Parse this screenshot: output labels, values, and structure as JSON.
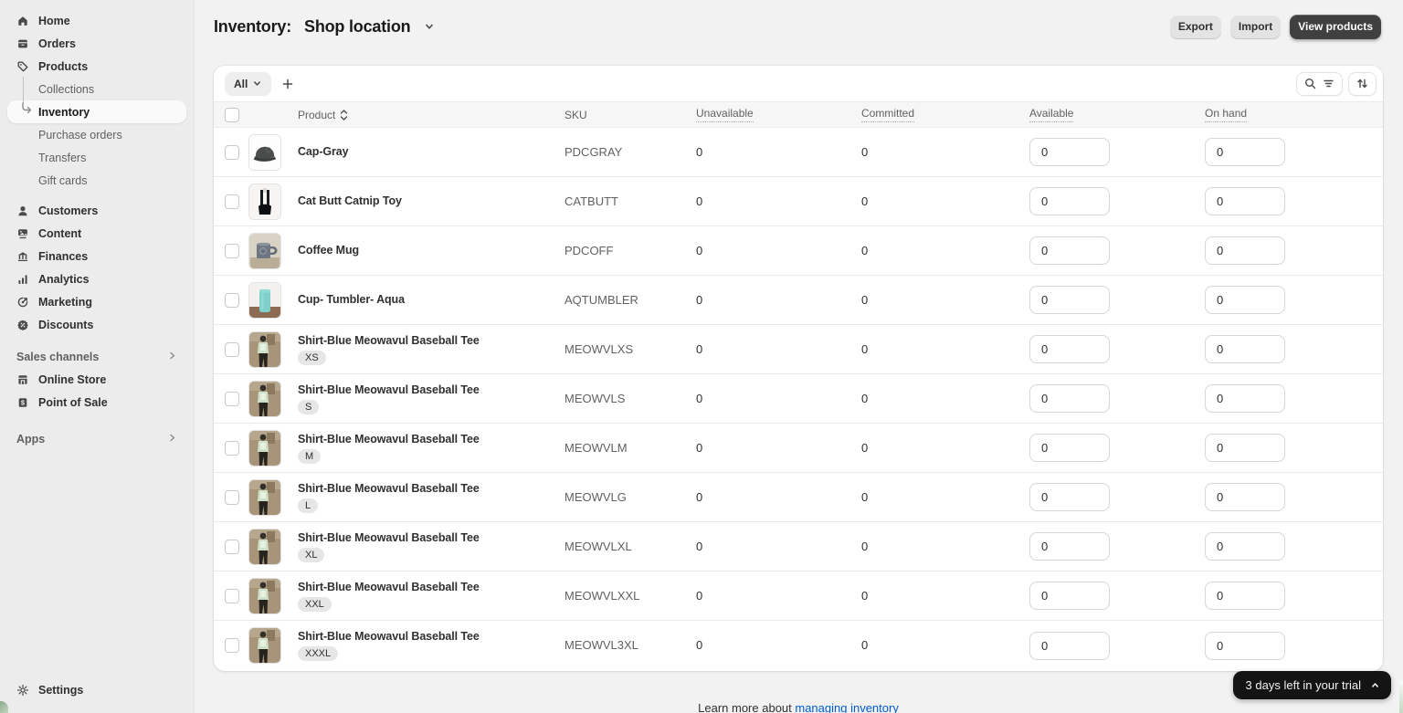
{
  "sidebar": {
    "items": [
      {
        "label": "Home",
        "icon": "home"
      },
      {
        "label": "Orders",
        "icon": "orders"
      },
      {
        "label": "Products",
        "icon": "products"
      },
      {
        "label": "Collections",
        "sub": true
      },
      {
        "label": "Inventory",
        "sub": true,
        "selected": true
      },
      {
        "label": "Purchase orders",
        "sub": true
      },
      {
        "label": "Transfers",
        "sub": true
      },
      {
        "label": "Gift cards",
        "sub": true
      },
      {
        "label": "Customers",
        "icon": "customers"
      },
      {
        "label": "Content",
        "icon": "content"
      },
      {
        "label": "Finances",
        "icon": "finances"
      },
      {
        "label": "Analytics",
        "icon": "analytics"
      },
      {
        "label": "Marketing",
        "icon": "marketing"
      },
      {
        "label": "Discounts",
        "icon": "discounts"
      }
    ],
    "sales_channels_label": "Sales channels",
    "channels": [
      {
        "label": "Online Store",
        "icon": "online-store"
      },
      {
        "label": "Point of Sale",
        "icon": "pos"
      }
    ],
    "apps_label": "Apps",
    "settings_label": "Settings"
  },
  "header": {
    "title": "Inventory:",
    "location": "Shop location"
  },
  "actions": {
    "export": "Export",
    "import": "Import",
    "view_products": "View products"
  },
  "table": {
    "filter_all": "All",
    "columns": {
      "product": "Product",
      "sku": "SKU",
      "unavailable": "Unavailable",
      "committed": "Committed",
      "available": "Available",
      "on_hand": "On hand"
    },
    "rows": [
      {
        "product": "Cap-Gray",
        "badge": "",
        "sku": "PDCGRAY",
        "unavailable": "0",
        "committed": "0",
        "available": "0",
        "on_hand": "0",
        "thumb": "cap"
      },
      {
        "product": "Cat Butt Catnip Toy",
        "badge": "",
        "sku": "CATBUTT",
        "unavailable": "0",
        "committed": "0",
        "available": "0",
        "on_hand": "0",
        "thumb": "cat"
      },
      {
        "product": "Coffee Mug",
        "badge": "",
        "sku": "PDCOFF",
        "unavailable": "0",
        "committed": "0",
        "available": "0",
        "on_hand": "0",
        "thumb": "mug"
      },
      {
        "product": "Cup- Tumbler- Aqua",
        "badge": "",
        "sku": "AQTUMBLER",
        "unavailable": "0",
        "committed": "0",
        "available": "0",
        "on_hand": "0",
        "thumb": "tumbler"
      },
      {
        "product": "Shirt-Blue Meowavul Baseball Tee",
        "badge": "XS",
        "sku": "MEOWVLXS",
        "unavailable": "0",
        "committed": "0",
        "available": "0",
        "on_hand": "0",
        "thumb": "shirt"
      },
      {
        "product": "Shirt-Blue Meowavul Baseball Tee",
        "badge": "S",
        "sku": "MEOWVLS",
        "unavailable": "0",
        "committed": "0",
        "available": "0",
        "on_hand": "0",
        "thumb": "shirt"
      },
      {
        "product": "Shirt-Blue Meowavul Baseball Tee",
        "badge": "M",
        "sku": "MEOWVLM",
        "unavailable": "0",
        "committed": "0",
        "available": "0",
        "on_hand": "0",
        "thumb": "shirt"
      },
      {
        "product": "Shirt-Blue Meowavul Baseball Tee",
        "badge": "L",
        "sku": "MEOWVLG",
        "unavailable": "0",
        "committed": "0",
        "available": "0",
        "on_hand": "0",
        "thumb": "shirt"
      },
      {
        "product": "Shirt-Blue Meowavul Baseball Tee",
        "badge": "XL",
        "sku": "MEOWVLXL",
        "unavailable": "0",
        "committed": "0",
        "available": "0",
        "on_hand": "0",
        "thumb": "shirt"
      },
      {
        "product": "Shirt-Blue Meowavul Baseball Tee",
        "badge": "XXL",
        "sku": "MEOWVLXXL",
        "unavailable": "0",
        "committed": "0",
        "available": "0",
        "on_hand": "0",
        "thumb": "shirt"
      },
      {
        "product": "Shirt-Blue Meowavul Baseball Tee",
        "badge": "XXXL",
        "sku": "MEOWVL3XL",
        "unavailable": "0",
        "committed": "0",
        "available": "0",
        "on_hand": "0",
        "thumb": "shirt"
      }
    ]
  },
  "footer": {
    "learn_more_prefix": "Learn more about ",
    "link": "managing inventory"
  },
  "trial": {
    "label": "3 days left in your trial"
  }
}
